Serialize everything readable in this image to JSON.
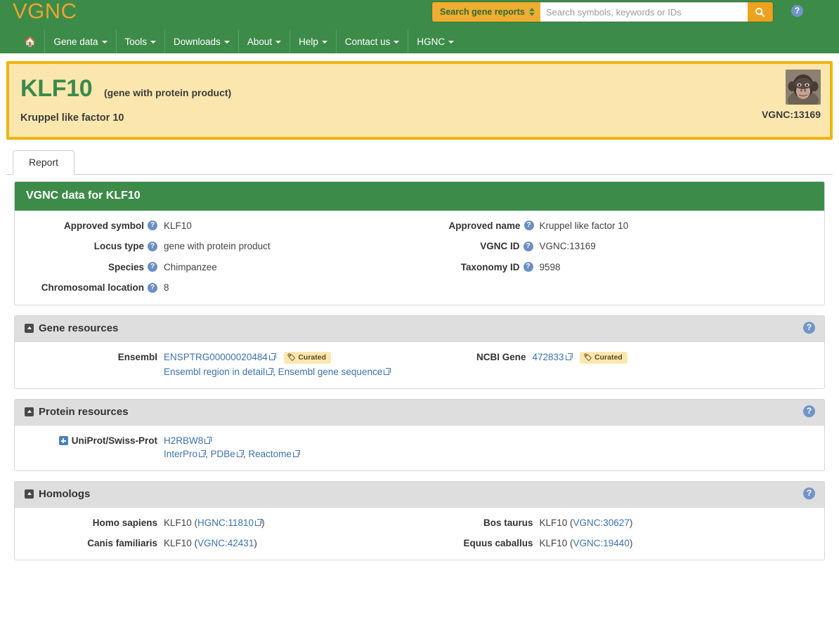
{
  "site": {
    "logo_text": "VGNC"
  },
  "search": {
    "scope_label": "Search gene reports",
    "placeholder": "Search symbols, keywords or IDs",
    "value": "",
    "search_icon": "search-icon",
    "help_icon": "help-icon"
  },
  "nav": {
    "home_icon": "home-icon",
    "items": [
      {
        "label": "Gene data",
        "has_caret": true
      },
      {
        "label": "Tools",
        "has_caret": true
      },
      {
        "label": "Downloads",
        "has_caret": true
      },
      {
        "label": "About",
        "has_caret": true
      },
      {
        "label": "Help",
        "has_caret": true
      },
      {
        "label": "Contact us",
        "has_caret": true
      },
      {
        "label": "HGNC",
        "has_caret": true
      }
    ]
  },
  "gene_banner": {
    "symbol": "KLF10",
    "locus_type": "(gene with protein product)",
    "name": "Kruppel like factor 10",
    "vgnc_id": "VGNC:13169",
    "species_image": "chimpanzee-photo"
  },
  "tabs": [
    {
      "label": "Report",
      "active": true
    }
  ],
  "report_panel": {
    "title": "VGNC data for KLF10",
    "left_fields": [
      {
        "label": "Approved symbol",
        "value": "KLF10"
      },
      {
        "label": "Locus type",
        "value": "gene with protein product"
      },
      {
        "label": "Species",
        "value": "Chimpanzee"
      },
      {
        "label": "Chromosomal location",
        "value": "8"
      }
    ],
    "right_fields": [
      {
        "label": "Approved name",
        "value": "Kruppel like factor 10"
      },
      {
        "label": "VGNC ID",
        "value": "VGNC:13169"
      },
      {
        "label": "Taxonomy ID",
        "value": "9598"
      }
    ]
  },
  "gene_resources": {
    "title": "Gene resources",
    "ensembl": {
      "label": "Ensembl",
      "id": "ENSPTRG00000020484",
      "badge": "Curated",
      "links": [
        "Ensembl region in detail",
        "Ensembl gene sequence"
      ],
      "separator": ", "
    },
    "ncbi": {
      "label": "NCBI Gene",
      "id": "472833",
      "badge": "Curated"
    }
  },
  "protein_resources": {
    "title": "Protein resources",
    "uniprot": {
      "label": "UniProt/Swiss-Prot",
      "id": "H2RBW8",
      "links": [
        "InterPro",
        "PDBe",
        "Reactome"
      ],
      "sep1": ", ",
      "sep2": ", "
    }
  },
  "homologs": {
    "title": "Homologs",
    "rows_left": [
      {
        "species": "Homo sapiens",
        "symbol": "KLF10",
        "open": " (",
        "id": "HGNC:11810",
        "external": true,
        "close": ")"
      },
      {
        "species": "Canis familiaris",
        "symbol": "KLF10",
        "open": " (",
        "id": "VGNC:42431",
        "external": false,
        "close": ")"
      }
    ],
    "rows_right": [
      {
        "species": "Bos taurus",
        "symbol": "KLF10",
        "open": " (",
        "id": "VGNC:30627",
        "external": false,
        "close": ")"
      },
      {
        "species": "Equus caballus",
        "symbol": "KLF10",
        "open": " (",
        "id": "VGNC:19440",
        "external": false,
        "close": ")"
      }
    ]
  },
  "colors": {
    "brand_green": "#3d8b49",
    "logo_orange": "#e8a433",
    "banner_bg": "#fbe7ae",
    "banner_border": "#efb411",
    "link_blue": "#3b72b0",
    "help_blue": "#6b8fc4"
  }
}
